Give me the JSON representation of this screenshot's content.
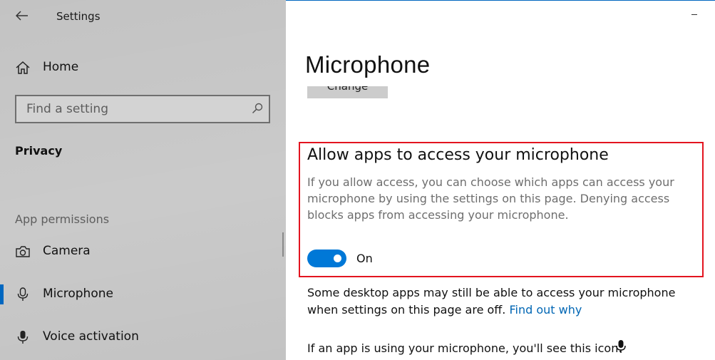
{
  "window": {
    "title": "Settings"
  },
  "sidebar": {
    "home_label": "Home",
    "search_placeholder": "Find a setting",
    "section_title": "Privacy",
    "group_label": "App permissions",
    "items": [
      {
        "label": "Camera",
        "icon": "camera-icon",
        "selected": false
      },
      {
        "label": "Microphone",
        "icon": "microphone-icon",
        "selected": true
      },
      {
        "label": "Voice activation",
        "icon": "voice-activation-icon",
        "selected": false
      }
    ]
  },
  "main": {
    "page_title": "Microphone",
    "change_button_label": "Change",
    "allow_section": {
      "heading": "Allow apps to access your microphone",
      "description": "If you allow access, you can choose which apps can access your microphone by using the settings on this page. Denying access blocks apps from accessing your microphone.",
      "toggle_state": "On",
      "toggle_on": true
    },
    "desktop_note": {
      "text": "Some desktop apps may still be able to access your microphone when settings on this page are off.",
      "link": "Find out why"
    },
    "icon_note": "If an app is using your microphone, you'll see this icon:"
  },
  "colors": {
    "sidebar_bg": "#c3c3c3",
    "accent": "#0078d7",
    "link": "#0066b4",
    "highlight_border": "#e3141f"
  }
}
